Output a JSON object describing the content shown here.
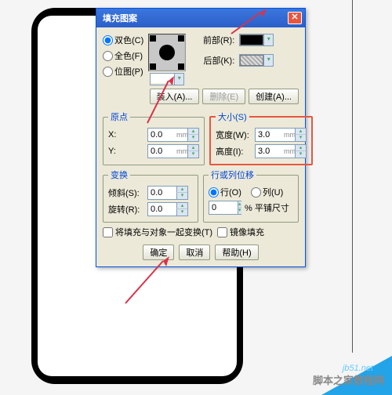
{
  "dialog": {
    "title": "填充图案",
    "modes": {
      "dual": "双色(C)",
      "full": "全色(F)",
      "bitmap": "位图(P)"
    },
    "swatch": {
      "front_label": "前部(R):",
      "back_label": "后部(K):",
      "front_color": "#000000",
      "back_color": "#c0c0c0"
    },
    "file_buttons": {
      "load": "装入(A)...",
      "delete": "删除(E)",
      "create": "创建(A)..."
    },
    "origin": {
      "legend": "原点",
      "x_label": "X:",
      "x_val": "0.0",
      "y_label": "Y:",
      "y_val": "0.0",
      "unit": "mm"
    },
    "size": {
      "legend": "大小(S)",
      "w_label": "宽度(W):",
      "w_val": "3.0",
      "h_label": "高度(I):",
      "h_val": "3.0",
      "unit": "mm"
    },
    "transform": {
      "legend": "变换",
      "skew_label": "倾斜(S):",
      "skew_val": "0.0",
      "rotate_label": "旋转(R):",
      "rotate_val": "0.0"
    },
    "offset": {
      "legend": "行或列位移",
      "row": "行(O)",
      "col": "列(U)",
      "val": "0",
      "suffix": "% 平铺尺寸"
    },
    "checks": {
      "with_obj": "将填充与对象一起变换(T)",
      "mirror": "镜像填充"
    },
    "buttons": {
      "ok": "确定",
      "cancel": "取消",
      "help": "帮助(H)"
    }
  },
  "watermark": {
    "url": "jb51.net",
    "text": "脚本之家教程网"
  }
}
